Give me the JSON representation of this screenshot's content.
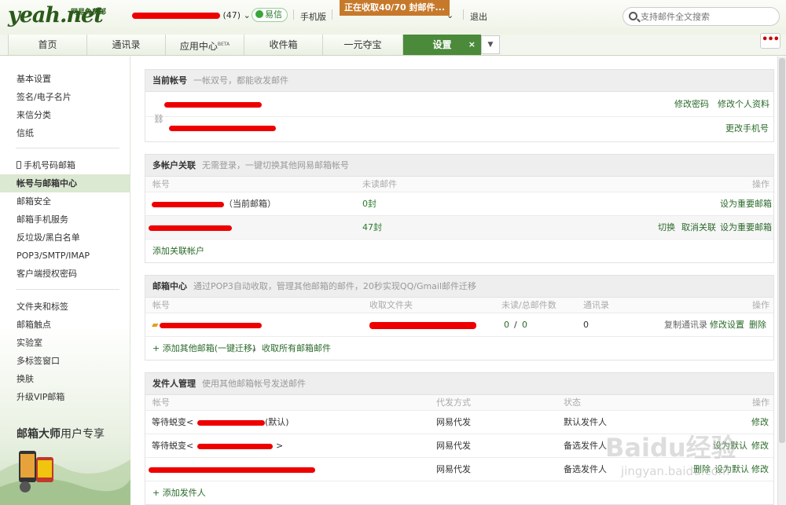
{
  "header": {
    "logo": "yeah.net",
    "logo_sub": "网易免费邮",
    "account_count": "(47)",
    "yixin": "易信",
    "mobile": "手机版",
    "banner": "正在收取40/70 封邮件...",
    "logout": "退出",
    "search_placeholder": "支持邮件全文搜索"
  },
  "tabs": [
    {
      "label": "首页"
    },
    {
      "label": "通讯录"
    },
    {
      "label": "应用中心",
      "badge": "BETA"
    },
    {
      "label": "收件箱"
    },
    {
      "label": "一元夺宝"
    },
    {
      "label": "设置",
      "close": "×"
    }
  ],
  "more_label": "•••",
  "sidebar": {
    "group1": [
      "基本设置",
      "签名/电子名片",
      "来信分类",
      "信纸"
    ],
    "group2": [
      "手机号码邮箱",
      "帐号与邮箱中心",
      "邮箱安全",
      "邮箱手机服务",
      "反垃圾/黑白名单",
      "POP3/SMTP/IMAP",
      "客户端授权密码"
    ],
    "group3": [
      "文件夹和标签",
      "邮箱触点",
      "实验室",
      "多标签窗口",
      "换肤",
      "升级VIP邮箱"
    ],
    "active": "帐号与邮箱中心",
    "promo_title": "邮箱大师",
    "promo_sub": "用户专享"
  },
  "current_account": {
    "title": "当前帐号",
    "desc": "一帐双号，都能收发邮件",
    "change_password": "修改密码",
    "edit_profile": "修改个人资料",
    "change_phone": "更改手机号"
  },
  "multi_account": {
    "title": "多帐户关联",
    "desc": "无需登录，一键切换其他网易邮箱帐号",
    "cols": {
      "account": "帐号",
      "unread": "未读邮件",
      "ops": "操作"
    },
    "rows": [
      {
        "suffix": "（当前邮箱）",
        "unread": "0封",
        "ops": [
          "设为重要邮箱"
        ]
      },
      {
        "suffix": "",
        "unread": "47封",
        "ops": [
          "切换",
          "取消关联",
          "设为重要邮箱"
        ]
      }
    ],
    "add": "添加关联帐户"
  },
  "mail_center": {
    "title": "邮箱中心",
    "desc": "通过POP3自动收取，管理其他邮箱的邮件，20秒实现QQ/Gmail邮件迁移",
    "cols": {
      "account": "帐号",
      "folder": "收取文件夹",
      "unread": "未读/总邮件数",
      "contacts": "通讯录",
      "ops": "操作"
    },
    "row": {
      "unread": "0",
      "slash": "/",
      "total": "0",
      "contacts": "0",
      "ops": [
        "复制通讯录",
        "修改设置",
        "删除"
      ]
    },
    "add_other": "+ 添加其他邮箱(一键迁移)",
    "fetch_all": "收取所有邮箱邮件"
  },
  "sender_mgmt": {
    "title": "发件人管理",
    "desc": "使用其他邮箱帐号发送邮件",
    "cols": {
      "account": "帐号",
      "method": "代发方式",
      "status": "状态",
      "ops": "操作"
    },
    "rows": [
      {
        "prefix": "等待蜕变<",
        "suffix": "(默认)",
        "method": "网易代发",
        "status": "默认发件人",
        "ops": [
          "修改"
        ]
      },
      {
        "prefix": "等待蜕变<",
        "suffix": ">",
        "method": "网易代发",
        "status": "备选发件人",
        "ops": [
          "设为默认",
          "修改"
        ]
      },
      {
        "prefix": "",
        "suffix": "",
        "method": "网易代发",
        "status": "备选发件人",
        "ops": [
          "删除",
          "设为默认",
          "修改"
        ]
      }
    ],
    "add": "+ 添加发件人"
  },
  "watermark": {
    "text": "Baidu经验",
    "url": "jingyan.baidu.com"
  },
  "colors": {
    "brand_green": "#4a8a3a",
    "link": "#2a6a2a",
    "redaction": "#e00000",
    "banner": "#c7792b"
  }
}
